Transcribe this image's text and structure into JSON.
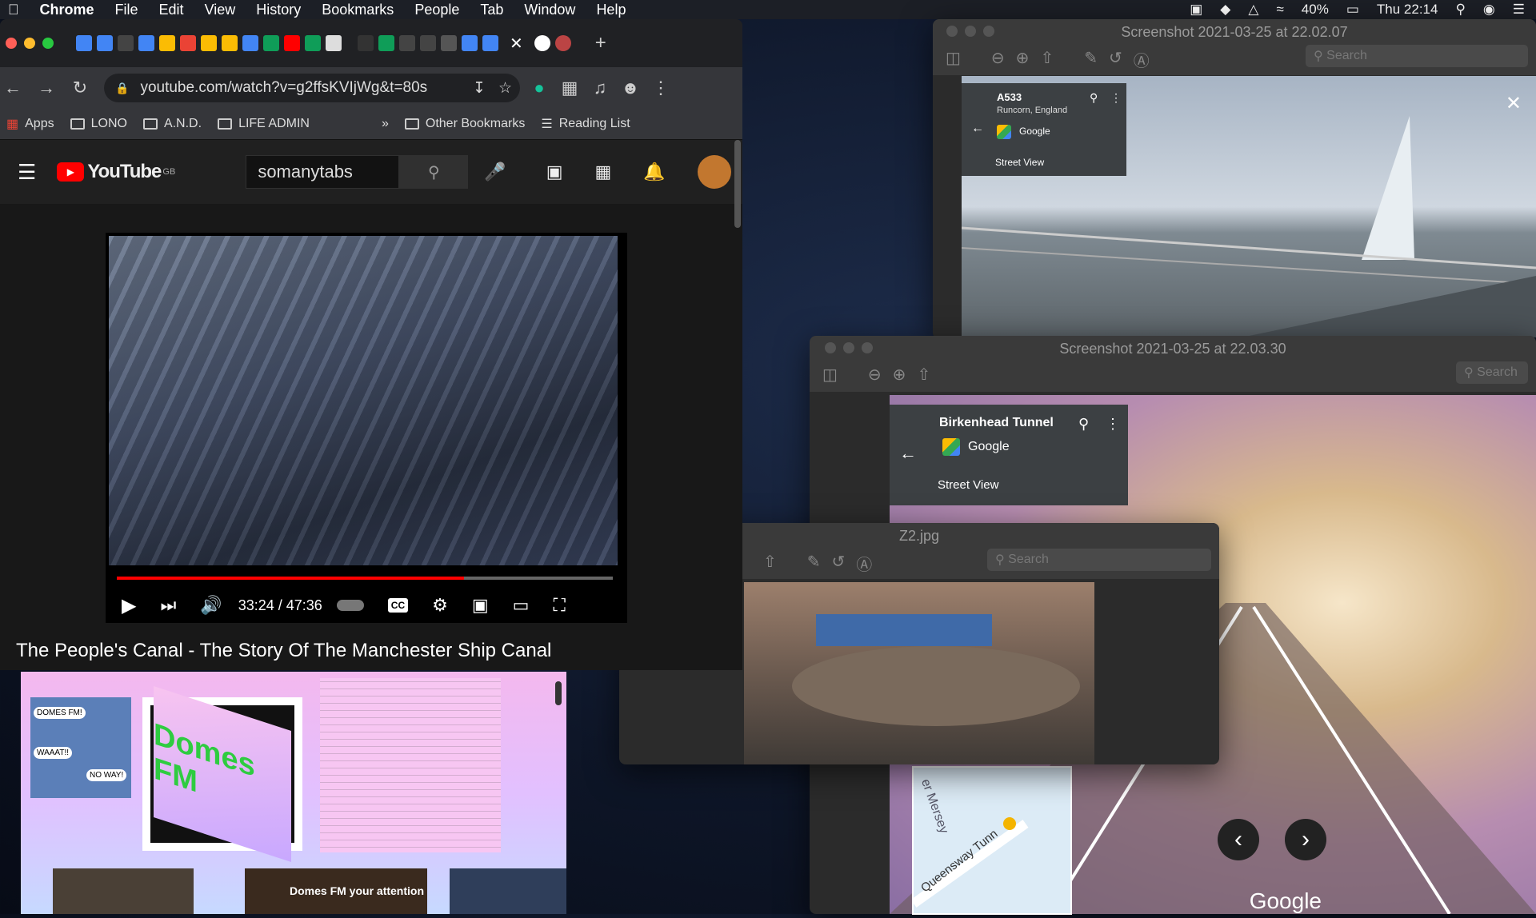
{
  "menubar": {
    "app": "Chrome",
    "items": [
      "File",
      "Edit",
      "View",
      "History",
      "Bookmarks",
      "People",
      "Tab",
      "Window",
      "Help"
    ],
    "battery": "40%",
    "clock": "Thu 22:14"
  },
  "chrome": {
    "url": "youtube.com/watch?v=g2ffsKVIjWg&t=80s",
    "bookmarks": [
      "Apps",
      "LONO",
      "A.N.D.",
      "LIFE ADMIN"
    ],
    "other_bookmarks": "Other Bookmarks",
    "reading_list": "Reading List",
    "overflow": "»"
  },
  "youtube": {
    "logo": "YouTube",
    "region": "GB",
    "search_value": "somanytabs",
    "time": "33:24 / 47:36",
    "progress": 0.7,
    "video_title": "The People's Canal - The Story Of The Manchester Ship Canal",
    "cc": "CC"
  },
  "preview1": {
    "title": "Screenshot 2021-03-25 at 22.02.07",
    "search_placeholder": "Search",
    "place_name": "A533",
    "place_sub": "Runcorn, England",
    "provider": "Google",
    "mode": "Street View"
  },
  "preview2": {
    "title": "Screenshot 2021-03-25 at 22.03.30",
    "search_placeholder": "Search",
    "place_name": "Birkenhead Tunnel",
    "provider": "Google",
    "mode": "Street View",
    "map_label1": "er Mersey",
    "map_label2": "Queensway Tunn",
    "watermark": "Google"
  },
  "preview3": {
    "title": "Z2.jpg",
    "search_placeholder": "Search"
  },
  "website": {
    "logo_text": "Domes FM",
    "bubble1": "DOMES FM!",
    "bubble2": "WAAAT!!",
    "bubble3": "NO WAY!",
    "thumb_caption": "Domes FM your attention"
  },
  "colors": {
    "accent_red": "#ff0000",
    "chrome_bg": "#202124"
  }
}
